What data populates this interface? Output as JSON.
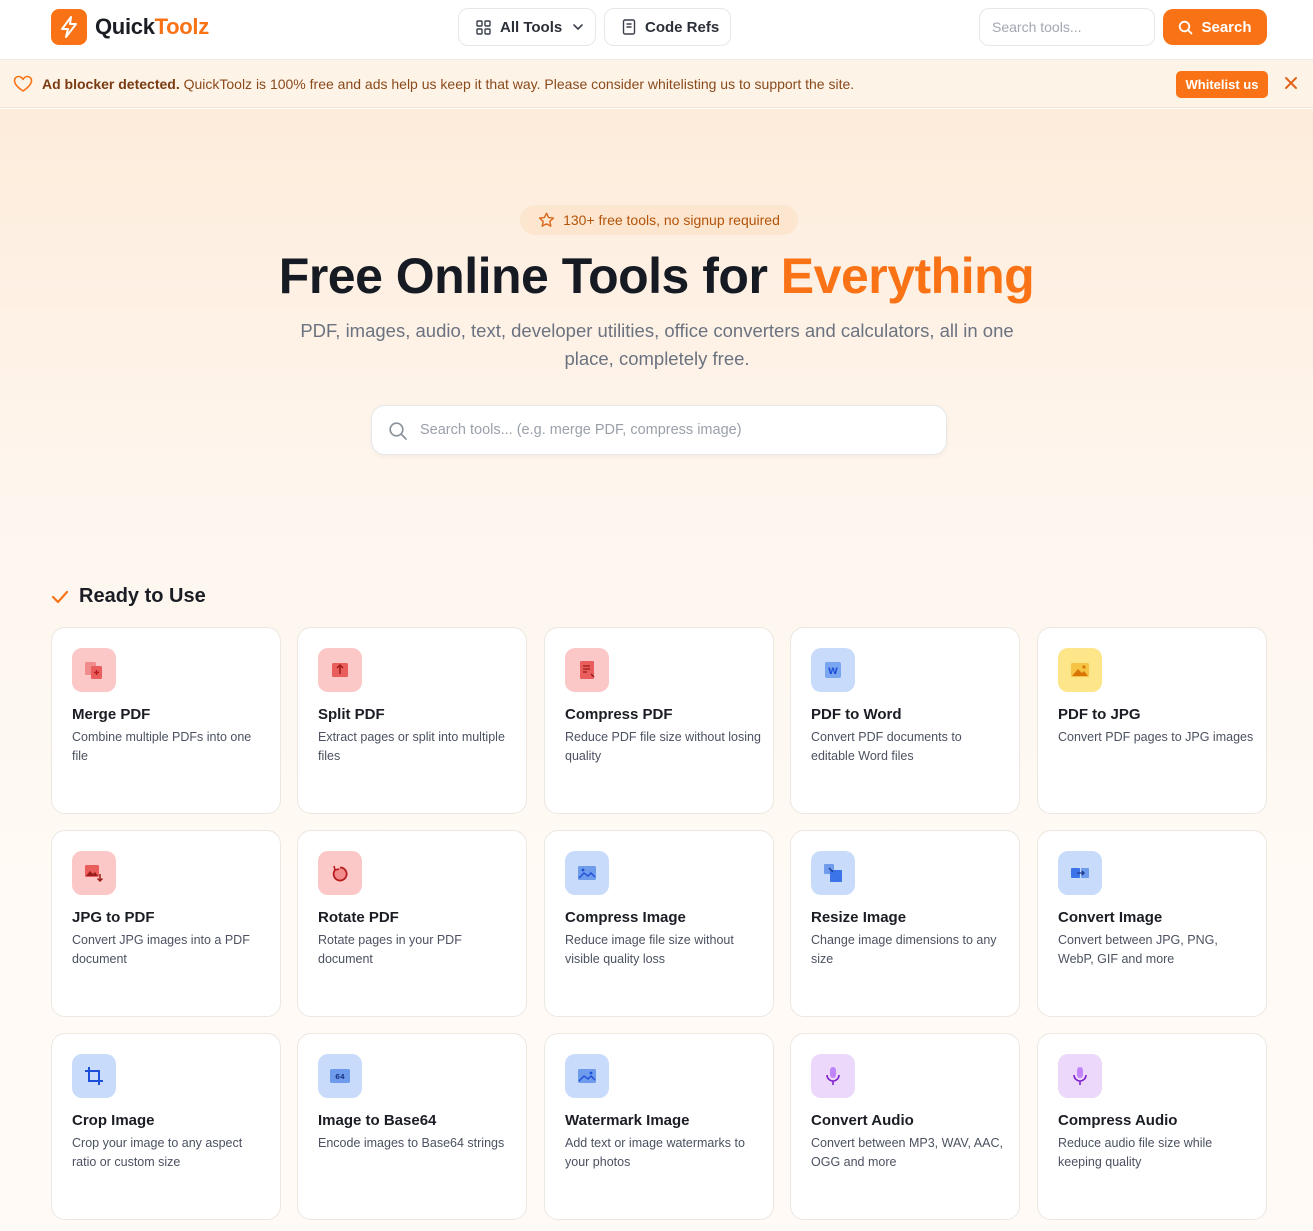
{
  "header": {
    "logo_part1": "Quick",
    "logo_part2": "Toolz",
    "nav_all_tools": "All Tools",
    "nav_code_refs": "Code Refs",
    "search_placeholder": "Search tools...",
    "search_button": "Search"
  },
  "adbar": {
    "strong": "Ad blocker detected.",
    "message": " QuickToolz is 100% free and ads help us keep it that way. Please consider whitelisting us to support the site.",
    "button": "Whitelist us"
  },
  "hero": {
    "pill": "130+ free tools, no signup required",
    "title": "Free Online Tools for ",
    "title_highlight": "Everything",
    "subtitle": "PDF, images, audio, text, developer utilities, office converters and calculators, all in one place, completely free.",
    "search_placeholder": "Search tools... (e.g. merge PDF, compress image)"
  },
  "section": {
    "title": "Ready to Use"
  },
  "tools": [
    {
      "title": "Merge PDF",
      "desc": "Combine multiple PDFs into one file",
      "color": "red",
      "icon": "merge-pdf-icon"
    },
    {
      "title": "Split PDF",
      "desc": "Extract pages or split into multiple files",
      "color": "red",
      "icon": "split-pdf-icon"
    },
    {
      "title": "Compress PDF",
      "desc": "Reduce PDF file size without losing quality",
      "color": "red",
      "icon": "compress-pdf-icon"
    },
    {
      "title": "PDF to Word",
      "desc": "Convert PDF documents to editable Word files",
      "color": "blue",
      "icon": "word-icon"
    },
    {
      "title": "PDF to JPG",
      "desc": "Convert PDF pages to JPG images",
      "color": "yellow",
      "icon": "image-icon"
    },
    {
      "title": "JPG to PDF",
      "desc": "Convert JPG images into a PDF document",
      "color": "red",
      "icon": "jpg-to-pdf-icon"
    },
    {
      "title": "Rotate PDF",
      "desc": "Rotate pages in your PDF document",
      "color": "red",
      "icon": "rotate-icon"
    },
    {
      "title": "Compress Image",
      "desc": "Reduce image file size without visible quality loss",
      "color": "blue",
      "icon": "image-icon"
    },
    {
      "title": "Resize Image",
      "desc": "Change image dimensions to any size",
      "color": "blue",
      "icon": "resize-icon"
    },
    {
      "title": "Convert Image",
      "desc": "Convert between JPG, PNG, WebP, GIF and more",
      "color": "blue",
      "icon": "convert-icon"
    },
    {
      "title": "Crop Image",
      "desc": "Crop your image to any aspect ratio or custom size",
      "color": "blue",
      "icon": "crop-icon"
    },
    {
      "title": "Image to Base64",
      "desc": "Encode images to Base64 strings",
      "color": "blue",
      "icon": "base64-icon",
      "badge": "64"
    },
    {
      "title": "Watermark Image",
      "desc": "Add text or image watermarks to your photos",
      "color": "blue",
      "icon": "image-icon"
    },
    {
      "title": "Convert Audio",
      "desc": "Convert between MP3, WAV, AAC, OGG and more",
      "color": "purple",
      "icon": "microphone-icon"
    },
    {
      "title": "Compress Audio",
      "desc": "Reduce audio file size while keeping quality",
      "color": "purple",
      "icon": "microphone-icon"
    }
  ],
  "colors": {
    "accent": "#f97316",
    "red_tile": "#fcc7c7",
    "blue_tile": "#c9dbfb",
    "yellow_tile": "#fde58a",
    "purple_tile": "#ecd8fb"
  }
}
